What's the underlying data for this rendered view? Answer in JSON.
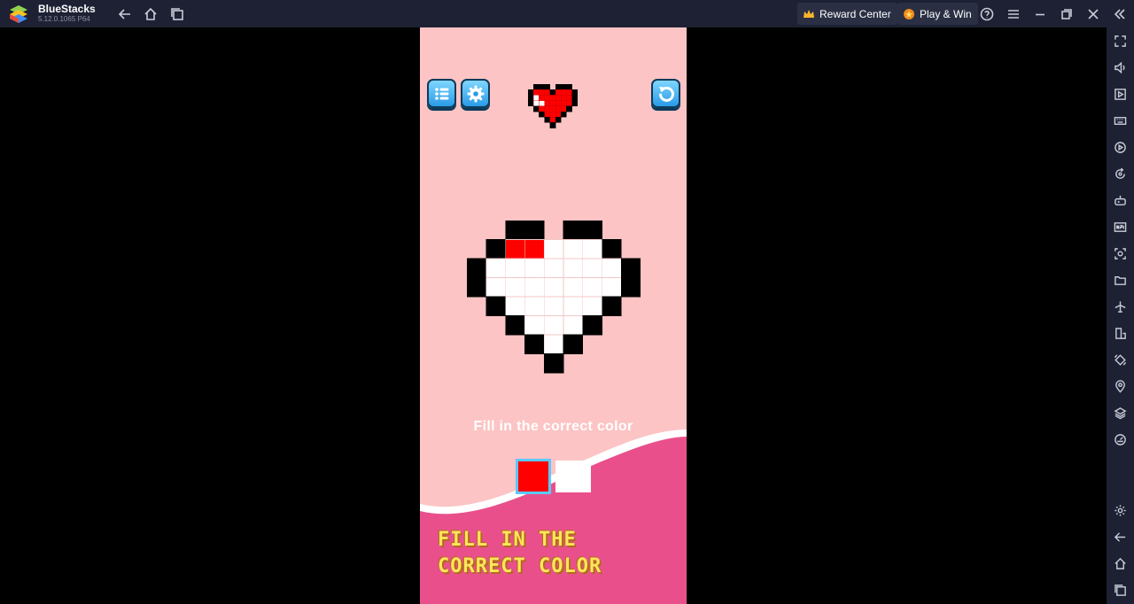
{
  "app": {
    "name": "BlueStacks",
    "version": "5.12.0.1065 P64"
  },
  "titlebar": {
    "reward_center": "Reward Center",
    "play_win": "Play & Win",
    "icons": [
      "back-icon",
      "home-icon",
      "multi-instance-icon",
      "help-icon",
      "menu-icon",
      "minimize-icon",
      "restore-icon",
      "close-icon",
      "collapse-sidebar-icon"
    ]
  },
  "sidebar": {
    "icons": [
      "fullscreen-icon",
      "volume-icon",
      "screen-record-icon",
      "keyboard-icon",
      "macro-icon",
      "rotate-sync-icon",
      "game-controls-icon",
      "install-apk-icon",
      "screenshot-icon",
      "folder-icon",
      "airplane-mode-icon",
      "resize-icon",
      "rotate-icon",
      "location-icon",
      "layers-icon",
      "eco-mode-icon",
      "settings-icon",
      "back-icon",
      "home-icon",
      "recent-apps-icon"
    ]
  },
  "game": {
    "instruction": "Fill in the correct color",
    "banner_line1": "Fill in the",
    "banner_line2": "correct color",
    "colors": {
      "background": "#fcc4c4",
      "wave": "#e9508b",
      "fill_red": "#ff0000",
      "outline": "#000000",
      "banner_text": "#ffe45c",
      "button": "#2a9be6"
    },
    "palette": [
      "#ff0000",
      "#ffffff"
    ],
    "selected_color": "#ff0000"
  }
}
